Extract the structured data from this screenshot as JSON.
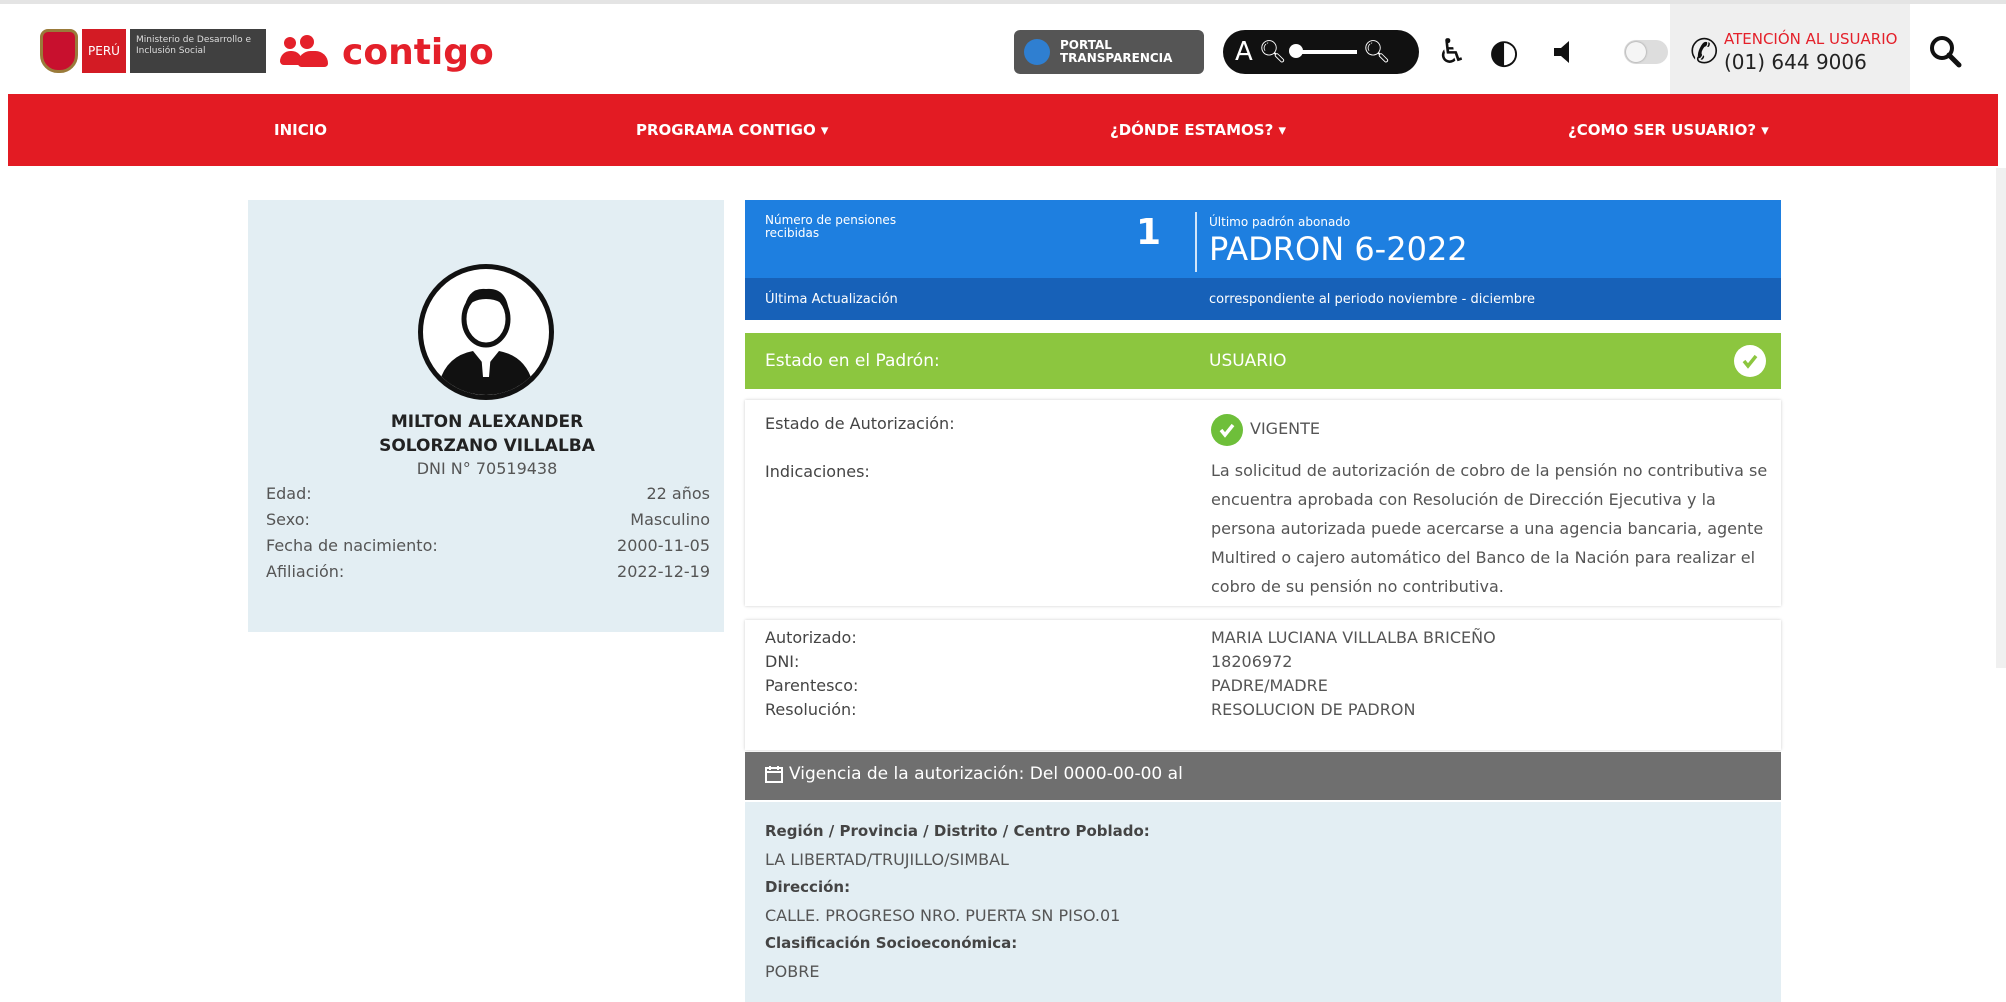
{
  "header": {
    "ministry_peru": "PERÚ",
    "ministry_name": "Ministerio de Desarrollo e Inclusión Social",
    "brand": "contigo",
    "portal_label": "PORTAL TRANSPARENCIA",
    "font_size_label": "A",
    "contact_label": "ATENCIÓN AL USUARIO",
    "contact_phone": "(01) 644 9006"
  },
  "nav": {
    "items": [
      "INICIO",
      "PROGRAMA CONTIGO ▾",
      "¿DÓNDE ESTAMOS? ▾",
      "¿COMO SER USUARIO? ▾"
    ]
  },
  "profile": {
    "name_line1": "MILTON ALEXANDER",
    "name_line2": "SOLORZANO VILLALBA",
    "dni": "DNI N° 70519438",
    "rows": [
      {
        "label": "Edad:",
        "value": "22 años"
      },
      {
        "label": "Sexo:",
        "value": "Masculino"
      },
      {
        "label": "Fecha de nacimiento:",
        "value": "2000-11-05"
      },
      {
        "label": "Afiliación:",
        "value": "2022-12-19"
      }
    ]
  },
  "summary": {
    "pensions_label": "Número de pensiones recibidas",
    "pensions_count": "1",
    "last_padron_label": "Último padrón abonado",
    "last_padron_value": "PADRON 6-2022",
    "last_update_label": "Última Actualización",
    "period_text": "correspondiente al periodo noviembre - diciembre"
  },
  "status": {
    "label": "Estado en el Padrón:",
    "value": "USUARIO"
  },
  "authorization": {
    "state_label": "Estado de Autorización:",
    "state_value": "VIGENTE",
    "indications_label": "Indicaciones:",
    "indications_text": "La solicitud de autorización de cobro de la pensión no contributiva se encuentra aprobada con Resolución de Dirección Ejecutiva y la persona autorizada puede acercarse a una agencia bancaria, agente Multired o cajero automático del Banco de la Nación para realizar el cobro de su pensión no contributiva."
  },
  "authorized": {
    "rows": [
      {
        "label": "Autorizado:",
        "value": "MARIA LUCIANA VILLALBA BRICEÑO"
      },
      {
        "label": "DNI:",
        "value": "18206972"
      },
      {
        "label": "Parentesco:",
        "value": "PADRE/MADRE"
      },
      {
        "label": "Resolución:",
        "value": "RESOLUCION DE PADRON"
      }
    ]
  },
  "validity": {
    "text": "Vigencia de la autorización: Del 0000-00-00 al"
  },
  "location": {
    "region_label": "Región / Provincia / Distrito / Centro Poblado:",
    "region_value": "LA LIBERTAD/TRUJILLO/SIMBAL",
    "address_label": "Dirección:",
    "address_value": "CALLE. PROGRESO NRO. PUERTA SN PISO.01",
    "socio_label": "Clasificación Socioeconómica:",
    "socio_value": "POBRE"
  },
  "colors": {
    "nav_red": "#e31b23",
    "panel_blue": "#1e7fe0",
    "panel_dark_blue": "#1761b8",
    "status_green": "#8cc63f",
    "validity_gray": "#6f6f6f",
    "card_light_blue": "#e3eef3"
  }
}
